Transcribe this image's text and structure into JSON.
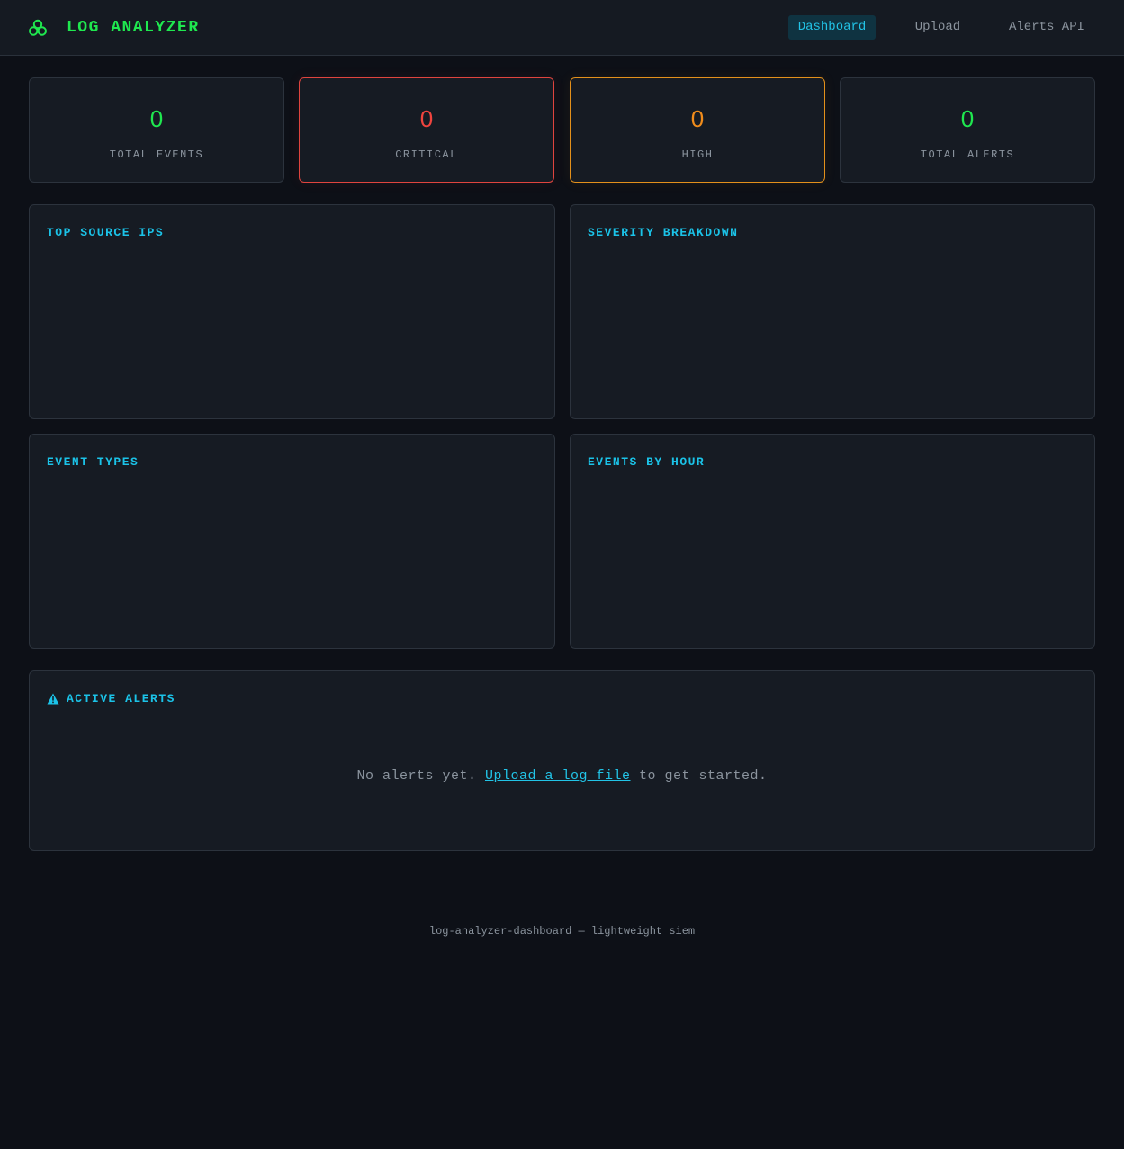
{
  "header": {
    "logo_icon": "biohazard-icon",
    "title": "LOG ANALYZER",
    "accent_color": "#1fe84f"
  },
  "nav": {
    "items": [
      {
        "label": "Dashboard",
        "active": true
      },
      {
        "label": "Upload",
        "active": false
      },
      {
        "label": "Alerts API",
        "active": false
      }
    ]
  },
  "stats": [
    {
      "value": "0",
      "label": "TOTAL EVENTS",
      "color": "#1fe84f"
    },
    {
      "value": "0",
      "label": "CRITICAL",
      "color": "#f0443e"
    },
    {
      "value": "0",
      "label": "HIGH",
      "color": "#f08c1b"
    },
    {
      "value": "0",
      "label": "TOTAL ALERTS",
      "color": "#1fe84f"
    }
  ],
  "panels": {
    "top_source_ips": "TOP SOURCE IPS",
    "severity_breakdown": "SEVERITY BREAKDOWN",
    "event_types": "EVENT TYPES",
    "events_by_hour": "EVENTS BY HOUR"
  },
  "alerts": {
    "icon": "warning-icon",
    "title": "ACTIVE ALERTS",
    "empty_prefix": "No alerts yet. ",
    "empty_link": "Upload a log file",
    "empty_suffix": " to get started."
  },
  "footer": {
    "text": "log-analyzer-dashboard — lightweight siem"
  },
  "colors": {
    "background": "#0d1017",
    "panel": "#161b23",
    "heading": "#1bc3e8"
  }
}
